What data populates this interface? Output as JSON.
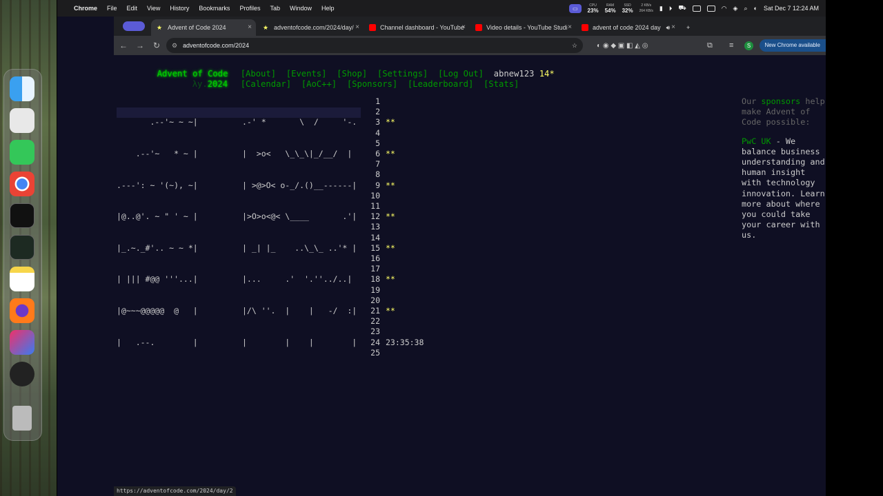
{
  "menubar": {
    "app": "Chrome",
    "items": [
      "File",
      "Edit",
      "View",
      "History",
      "Bookmarks",
      "Profiles",
      "Tab",
      "Window",
      "Help"
    ],
    "cpu_label": "CPU",
    "cpu": "23%",
    "ram_label": "RAM",
    "ram": "54%",
    "ssd_label": "SSD",
    "ssd": "32%",
    "net_up": "2 KB/s",
    "net_down": "264 KB/s",
    "datetime": "Sat Dec 7  12:24 AM"
  },
  "tabs": [
    {
      "title": "Advent of Code 2024",
      "active": true
    },
    {
      "title": "adventofcode.com/2024/day/"
    },
    {
      "title": "Channel dashboard - YouTube"
    },
    {
      "title": "Video details - YouTube Studi"
    },
    {
      "title": "advent of code 2024 day"
    }
  ],
  "toolbar": {
    "url": "adventofcode.com/2024",
    "new_chrome": "New Chrome available",
    "profile_initial": "S"
  },
  "aoc": {
    "logo": "Advent of Code",
    "year_prefix": "λy.",
    "year": "2024",
    "nav1": [
      "[About]",
      "[Events]",
      "[Shop]",
      "[Settings]",
      "[Log Out]"
    ],
    "username": "abnew123",
    "user_stars": "14*",
    "nav2": [
      "[Calendar]",
      "[AoC++]",
      "[Sponsors]",
      "[Leaderboard]",
      "[Stats]"
    ],
    "art_left": [
      "       .--'~ ~ ~|",
      "    .--'~   * ~ |",
      ".---': ~ '(~), ~|",
      "|@..@'. ~ \" ' ~ |",
      "|_.~._#'.. ~ ~ *|",
      "| ||| #@@ '''...|",
      "|@~~~@@@@@  @   |",
      "|   .--.        |"
    ],
    "art_right": [
      ".-' *       \\  /     '-.",
      "|  >o<   \\_\\_\\|_/__/  |",
      "| >@>O< o-_/.()__------|",
      "|>O>o<@< \\____       .'|",
      "| _| |_    ..\\_\\_ ..'* |",
      "|...     .'  '.''../..|",
      "|/\\ ''.  |    |   -/  :|",
      "|        |    |        |"
    ],
    "days": [
      "1",
      "2",
      "3",
      "4",
      "5",
      "6",
      "7",
      "8",
      "9",
      "10",
      "11",
      "12",
      "13",
      "14",
      "15",
      "16",
      "17",
      "18",
      "19",
      "20",
      "21",
      "22",
      "23",
      "24",
      "25"
    ],
    "day_stars": [
      "**",
      "**",
      "**",
      "**",
      "**",
      "**",
      "**"
    ],
    "countdown": "23:35:38",
    "sponsor_intro_1": "Our ",
    "sponsor_word": "sponsors",
    "sponsor_intro_2": " help make Advent of Code possible:",
    "sponsor_name": "PwC UK",
    "sponsor_text": " - We balance business understanding and human insight with technology innovation. Learn more about where you could take your career with us."
  },
  "statusbar": {
    "url": "https://adventofcode.com/2024/day/2"
  },
  "colors": {
    "bg": "#0f0f23",
    "green": "#00cc00",
    "link": "#009900",
    "star": "#ffff66",
    "text": "#cccccc"
  }
}
